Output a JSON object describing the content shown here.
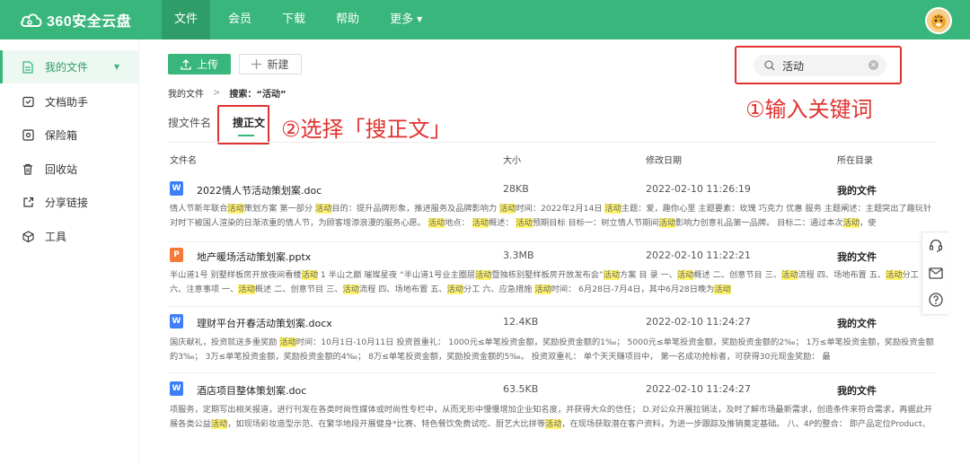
{
  "app": {
    "logo_text": "360安全云盘"
  },
  "nav": [
    {
      "label": "文件",
      "active": true
    },
    {
      "label": "会员"
    },
    {
      "label": "下载"
    },
    {
      "label": "帮助"
    },
    {
      "label": "更多"
    }
  ],
  "sidebar": [
    {
      "label": "我的文件",
      "active": true
    },
    {
      "label": "文档助手"
    },
    {
      "label": "保险箱"
    },
    {
      "label": "回收站"
    },
    {
      "label": "分享链接"
    },
    {
      "label": "工具"
    }
  ],
  "toolbar": {
    "upload_label": "上传",
    "new_label": "新建"
  },
  "search": {
    "value": "活动"
  },
  "annotations": {
    "step1": "①输入关键词",
    "step2": "②选择「搜正文」"
  },
  "breadcrumb": {
    "root": "我的文件",
    "sep": ">",
    "current": "搜索：“活动”"
  },
  "tabs": [
    {
      "label": "搜文件名"
    },
    {
      "label": "搜正文",
      "active": true
    }
  ],
  "columns": {
    "name": "文件名",
    "size": "大小",
    "date": "修改日期",
    "location": "所在目录"
  },
  "rows": [
    {
      "icon": "word-doc-icon",
      "icon_char": "W",
      "type": "w",
      "name": "2022情人节活动策划案.doc",
      "size": "28KB",
      "date": "2022-02-10 11:26:19",
      "location": "我的文件",
      "snippet": "情人节新年联合[活动]策划方案 第一部分 [活动]目的：提升品牌形象，推进服务及品牌影响力 [活动]时间：2022年2月14日 [活动]主题：爱，趣你心里 主题要素：玫瑰 巧克力 优惠 服务 主题阐述：主题突出了趣玩针对时下被国人渲染的日渐浓重的情人节，为顾客增添浪漫的服务心愿。 [活动]地点： [活动]概述： [活动]预期目标 目标一：树立情人节期间[活动]影响力创意礼品第一品牌。 目标二：通过本次[活动]，使"
    },
    {
      "icon": "ppt-doc-icon",
      "icon_char": "P",
      "type": "p",
      "name": "地产暖场活动策划案.pptx",
      "size": "3.3MB",
      "date": "2022-02-10 11:22:21",
      "location": "我的文件",
      "snippet": "半山道1号 别墅样板房开放夜间看楼[活动] 1 半山之巅 璀璨星夜 “半山道1号业主圈层[活动]暨独栋别墅样板房开放发布会”[活动]方案 目 录 一、[活动]概述 二、创意节目 三、[活动]流程 四、场地布置 五、[活动]分工 六、注意事项 一、[活动]概述 二、创意节目 三、[活动]流程 四、场地布置 五、[活动]分工 六、应急措施 [活动]时间： 6月28日-7月4日，其中6月28日晚为[活动]"
    },
    {
      "icon": "word-doc-icon",
      "icon_char": "W",
      "type": "w",
      "name": "理财平台开春活动策划案.docx",
      "size": "12.4KB",
      "date": "2022-02-10 11:24:27",
      "location": "我的文件",
      "snippet": "国庆献礼，投资就送多重奖励 [活动]时间：10月1日-10月11日 投资首重礼：  1000元≤单笔投资金额，奖励投资金额的1‰；  5000元≤单笔投资金额，奖励投资金额的2‰；  1万≤单笔投资金额，奖励投资金额的3‰；  3万≤单笔投资金额，奖励投资金额的4‰；  8万≤单笔投资金额，奖励投资金额的5‰。 投资双重礼：  单个天天赚项目中，  第一名成功抢标者，可获得30元现金奖励：  最"
    },
    {
      "icon": "word-doc-icon",
      "icon_char": "W",
      "type": "w",
      "name": "酒店项目整体策划案.doc",
      "size": "63.5KB",
      "date": "2022-02-10 11:24:27",
      "location": "我的文件",
      "snippet": "项服务，定期写出相关报道，进行刊发在各类时尚性媒体或时尚性专栏中，从而无形中慢慢增加企业知名度，并获得大众的信任； D.对公众开展拉销法，及时了解市场最新需求，创造条件来符合需求，再据此开展各类公益[活动]，如现场彩妆造型示范、在繁华地段开展健身*比赛、特色餐饮免费试吃、厨艺大比拼等[活动]，在现场获取潜在客户资料，为进一步跟踪及推销奠定基础。 八、4P的整合：  即产品定位Product、价格定"
    }
  ],
  "colors": {
    "brand": "#39b67c",
    "annotation": "#e0322f",
    "highlight": "#fff36b"
  }
}
